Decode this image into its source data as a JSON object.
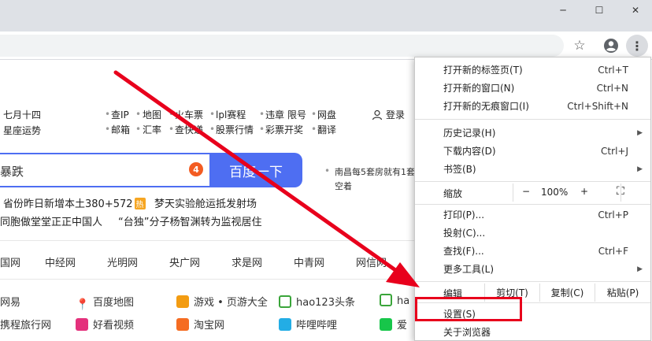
{
  "window": {
    "minimize_glyph": "─",
    "maximize_glyph": "☐",
    "close_glyph": "✕"
  },
  "toolbar": {
    "star_glyph": "☆",
    "more_glyph": "⋮"
  },
  "page": {
    "date_line1": "七月十四",
    "date_line2": "星座运势",
    "links_row1": [
      "查IP",
      "地图",
      "火车票",
      "lpl赛程",
      "违章",
      "限号",
      "网盘"
    ],
    "links_row2": [
      "邮箱",
      "汇率",
      "查快递",
      "股票行情",
      "彩票开奖",
      "翻译"
    ],
    "login": "登录",
    "search_value": "暴跌",
    "search_badge": "4",
    "search_button": "百度一下",
    "side_news_1": "南昌每5套房就有1套",
    "side_news_2": "空着",
    "hot_1": "省份昨日新增本土380+572",
    "hot_tag": "热",
    "hot_2": "梦天实验舱运抵发射场",
    "hot_3": "同胞做堂堂正正中国人",
    "hot_4": "“台独”分子杨智渊转为监视居住",
    "nav": [
      "国网",
      "中经网",
      "光明网",
      "央广网",
      "求是网",
      "中青网",
      "网信网"
    ],
    "sites_row1": [
      "网易",
      "百度地图",
      "游戏 • 页游大全",
      "hao123头条",
      "ha"
    ],
    "sites_row2": [
      "携程旅行网",
      "好看视频",
      "淘宝网",
      "哔哩哔哩",
      "爱"
    ]
  },
  "menu": {
    "new_tab": {
      "label": "打开新的标签页(T)",
      "shortcut": "Ctrl+T"
    },
    "new_window": {
      "label": "打开新的窗口(N)",
      "shortcut": "Ctrl+N"
    },
    "incognito": {
      "label": "打开新的无痕窗口(I)",
      "shortcut": "Ctrl+Shift+N"
    },
    "history": {
      "label": "历史记录(H)"
    },
    "downloads": {
      "label": "下载内容(D)",
      "shortcut": "Ctrl+J"
    },
    "bookmarks": {
      "label": "书签(B)"
    },
    "zoom": {
      "label": "缩放",
      "minus": "−",
      "value": "100%",
      "plus": "+",
      "fullscreen": "⛶"
    },
    "print": {
      "label": "打印(P)...",
      "shortcut": "Ctrl+P"
    },
    "cast": {
      "label": "投射(C)..."
    },
    "find": {
      "label": "查找(F)...",
      "shortcut": "Ctrl+F"
    },
    "more_tools": {
      "label": "更多工具(L)"
    },
    "edit": {
      "label": "编辑",
      "cut": "剪切(T)",
      "copy": "复制(C)",
      "paste": "粘贴(P)"
    },
    "settings": {
      "label": "设置(S)"
    },
    "about": {
      "label": "关于浏览器"
    }
  },
  "colors": {
    "accent": "#4e6ef2",
    "highlight": "#e8001c",
    "arrow": "#e8001c"
  }
}
